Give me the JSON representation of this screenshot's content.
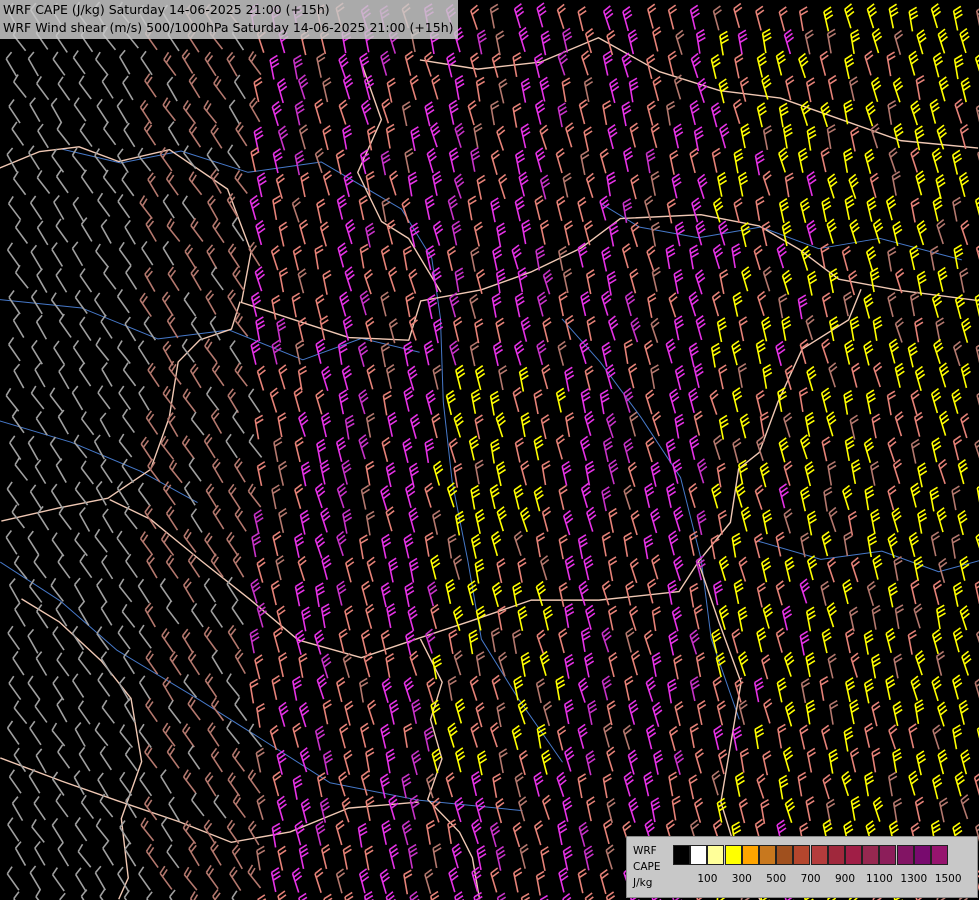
{
  "titles": {
    "line1": "WRF CAPE (J/kg) Saturday 14-06-2025 21:00 (+15h)",
    "line2": "WRF Wind shear (m/s) 500/1000hPa Saturday 14-06-2025 21:00 (+15h)"
  },
  "legend": {
    "labels": [
      "WRF",
      "CAPE",
      "J/kg"
    ],
    "tick_labels": [
      "100",
      "300",
      "500",
      "700",
      "900",
      "1100",
      "1300",
      "1500"
    ],
    "colors": [
      "#000000",
      "#ffffff",
      "#ffff99",
      "#ffff00",
      "#ffa500",
      "#c8781e",
      "#a0501e",
      "#b4462d",
      "#b43c3c",
      "#a0283c",
      "#a01e46",
      "#962850",
      "#8c1e5a",
      "#821464",
      "#780a6e",
      "#96146e"
    ]
  },
  "map": {
    "background": "#000000",
    "border_color": "#f0c8b4",
    "river_color": "#4678c8",
    "barb_colors": {
      "gray": "#a0a0a0",
      "brown": "#b4786e",
      "salmon": "#e68278",
      "yellow": "#ffff00",
      "magenta": "#e632e6",
      "violet": "#c832c8"
    }
  }
}
